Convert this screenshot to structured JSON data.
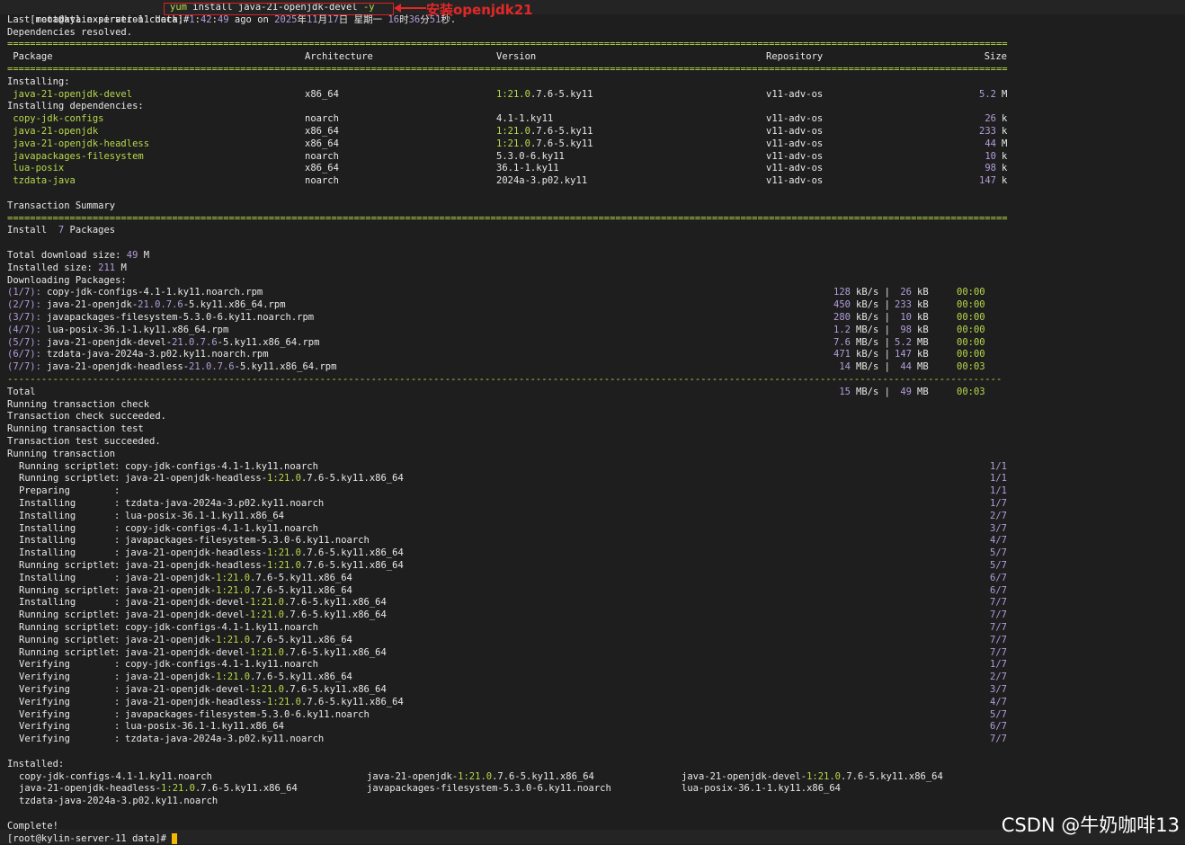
{
  "prompt": "[root@kylin-server-11 data]#",
  "command": "yum install java-21-openjdk-devel -y",
  "annotation": "安装openjdk21",
  "meta_line": "Last metadata expiration check: 1:42:49 ago on 2025年11月17日 星期一 16时36分51秒.",
  "deps_resolved": "Dependencies resolved.",
  "separator": "================================================================================================================================================================================",
  "dash_separator": "-------------------------------------------------------------------------------------------------------------------------------------------------------------------------------",
  "table_headers": {
    "package": "Package",
    "arch": "Architecture",
    "version": "Version",
    "repo": "Repository",
    "size": "Size"
  },
  "installing_label": "Installing:",
  "installing": [
    {
      "name": "java-21-openjdk-devel",
      "arch": "x86_64",
      "version": "1:21.0.7.6-5.ky11",
      "repo": "v11-adv-os",
      "size": "5.2",
      "unit": "M"
    }
  ],
  "deps_label": "Installing dependencies:",
  "dependencies": [
    {
      "name": "copy-jdk-configs",
      "arch": "noarch",
      "version": "4.1-1.ky11",
      "repo": "v11-adv-os",
      "size": "26",
      "unit": "k"
    },
    {
      "name": "java-21-openjdk",
      "arch": "x86_64",
      "version": "1:21.0.7.6-5.ky11",
      "repo": "v11-adv-os",
      "size": "233",
      "unit": "k"
    },
    {
      "name": "java-21-openjdk-headless",
      "arch": "x86_64",
      "version": "1:21.0.7.6-5.ky11",
      "repo": "v11-adv-os",
      "size": "44",
      "unit": "M"
    },
    {
      "name": "javapackages-filesystem",
      "arch": "noarch",
      "version": "5.3.0-6.ky11",
      "repo": "v11-adv-os",
      "size": "10",
      "unit": "k"
    },
    {
      "name": "lua-posix",
      "arch": "x86_64",
      "version": "36.1-1.ky11",
      "repo": "v11-adv-os",
      "size": "98",
      "unit": "k"
    },
    {
      "name": "tzdata-java",
      "arch": "noarch",
      "version": "2024a-3.p02.ky11",
      "repo": "v11-adv-os",
      "size": "147",
      "unit": "k"
    }
  ],
  "summary_label": "Transaction Summary",
  "install_summary": "Install  7 Packages",
  "download_size": "Total download size: 49 M",
  "installed_size": "Installed size: 211 M",
  "downloading_label": "Downloading Packages:",
  "downloads": [
    {
      "idx": "(1/7):",
      "file": "copy-jdk-configs-4.1-1.ky11.noarch.rpm",
      "rate": "128",
      "ru": "kB/s",
      "size": "26",
      "su": "kB",
      "time": "00:00"
    },
    {
      "idx": "(2/7):",
      "file": "java-21-openjdk-21.0.7.6-5.ky11.x86_64.rpm",
      "rate": "450",
      "ru": "kB/s",
      "size": "233",
      "su": "kB",
      "time": "00:00"
    },
    {
      "idx": "(3/7):",
      "file": "javapackages-filesystem-5.3.0-6.ky11.noarch.rpm",
      "rate": "280",
      "ru": "kB/s",
      "size": "10",
      "su": "kB",
      "time": "00:00"
    },
    {
      "idx": "(4/7):",
      "file": "lua-posix-36.1-1.ky11.x86_64.rpm",
      "rate": "1.2",
      "ru": "MB/s",
      "size": "98",
      "su": "kB",
      "time": "00:00"
    },
    {
      "idx": "(5/7):",
      "file": "java-21-openjdk-devel-21.0.7.6-5.ky11.x86_64.rpm",
      "rate": "7.6",
      "ru": "MB/s",
      "size": "5.2",
      "su": "MB",
      "time": "00:00"
    },
    {
      "idx": "(6/7):",
      "file": "tzdata-java-2024a-3.p02.ky11.noarch.rpm",
      "rate": "471",
      "ru": "kB/s",
      "size": "147",
      "su": "kB",
      "time": "00:00"
    },
    {
      "idx": "(7/7):",
      "file": "java-21-openjdk-headless-21.0.7.6-5.ky11.x86_64.rpm",
      "rate": "14",
      "ru": "MB/s",
      "size": "44",
      "su": "MB",
      "time": "00:03"
    }
  ],
  "total": {
    "label": "Total",
    "rate": "15",
    "ru": "MB/s",
    "size": "49",
    "su": "MB",
    "time": "00:03"
  },
  "status_lines": [
    "Running transaction check",
    "Transaction check succeeded.",
    "Running transaction test",
    "Transaction test succeeded.",
    "Running transaction"
  ],
  "transaction": [
    {
      "action": "Running scriptlet",
      "pkg": "copy-jdk-configs-4.1-1.ky11.noarch",
      "prog": "1/1"
    },
    {
      "action": "Running scriptlet",
      "pkg": "java-21-openjdk-headless-1:21.0.7.6-5.ky11.x86_64",
      "prog": "1/1"
    },
    {
      "action": "Preparing        ",
      "pkg": "",
      "prog": "1/1"
    },
    {
      "action": "Installing       ",
      "pkg": "tzdata-java-2024a-3.p02.ky11.noarch",
      "prog": "1/7"
    },
    {
      "action": "Installing       ",
      "pkg": "lua-posix-36.1-1.ky11.x86_64",
      "prog": "2/7"
    },
    {
      "action": "Installing       ",
      "pkg": "copy-jdk-configs-4.1-1.ky11.noarch",
      "prog": "3/7"
    },
    {
      "action": "Installing       ",
      "pkg": "javapackages-filesystem-5.3.0-6.ky11.noarch",
      "prog": "4/7"
    },
    {
      "action": "Installing       ",
      "pkg": "java-21-openjdk-headless-1:21.0.7.6-5.ky11.x86_64",
      "prog": "5/7"
    },
    {
      "action": "Running scriptlet",
      "pkg": "java-21-openjdk-headless-1:21.0.7.6-5.ky11.x86_64",
      "prog": "5/7"
    },
    {
      "action": "Installing       ",
      "pkg": "java-21-openjdk-1:21.0.7.6-5.ky11.x86_64",
      "prog": "6/7"
    },
    {
      "action": "Running scriptlet",
      "pkg": "java-21-openjdk-1:21.0.7.6-5.ky11.x86_64",
      "prog": "6/7"
    },
    {
      "action": "Installing       ",
      "pkg": "java-21-openjdk-devel-1:21.0.7.6-5.ky11.x86_64",
      "prog": "7/7"
    },
    {
      "action": "Running scriptlet",
      "pkg": "java-21-openjdk-devel-1:21.0.7.6-5.ky11.x86_64",
      "prog": "7/7"
    },
    {
      "action": "Running scriptlet",
      "pkg": "copy-jdk-configs-4.1-1.ky11.noarch",
      "prog": "7/7"
    },
    {
      "action": "Running scriptlet",
      "pkg": "java-21-openjdk-1:21.0.7.6-5.ky11.x86_64",
      "prog": "7/7"
    },
    {
      "action": "Running scriptlet",
      "pkg": "java-21-openjdk-devel-1:21.0.7.6-5.ky11.x86_64",
      "prog": "7/7"
    },
    {
      "action": "Verifying        ",
      "pkg": "copy-jdk-configs-4.1-1.ky11.noarch",
      "prog": "1/7"
    },
    {
      "action": "Verifying        ",
      "pkg": "java-21-openjdk-1:21.0.7.6-5.ky11.x86_64",
      "prog": "2/7"
    },
    {
      "action": "Verifying        ",
      "pkg": "java-21-openjdk-devel-1:21.0.7.6-5.ky11.x86_64",
      "prog": "3/7"
    },
    {
      "action": "Verifying        ",
      "pkg": "java-21-openjdk-headless-1:21.0.7.6-5.ky11.x86_64",
      "prog": "4/7"
    },
    {
      "action": "Verifying        ",
      "pkg": "javapackages-filesystem-5.3.0-6.ky11.noarch",
      "prog": "5/7"
    },
    {
      "action": "Verifying        ",
      "pkg": "lua-posix-36.1-1.ky11.x86_64",
      "prog": "6/7"
    },
    {
      "action": "Verifying        ",
      "pkg": "tzdata-java-2024a-3.p02.ky11.noarch",
      "prog": "7/7"
    }
  ],
  "installed_label": "Installed:",
  "installed": [
    "copy-jdk-configs-4.1-1.ky11.noarch",
    "java-21-openjdk-1:21.0.7.6-5.ky11.x86_64",
    "java-21-openjdk-devel-1:21.0.7.6-5.ky11.x86_64",
    "java-21-openjdk-headless-1:21.0.7.6-5.ky11.x86_64",
    "javapackages-filesystem-5.3.0-6.ky11.noarch",
    "lua-posix-36.1-1.ky11.x86_64",
    "tzdata-java-2024a-3.p02.ky11.noarch"
  ],
  "complete": "Complete!",
  "watermark": "CSDN @牛奶咖啡13",
  "colors": {
    "highlight": "#b7d94a",
    "number": "#b39ddb",
    "annotation": "#e32727",
    "cursor": "#f5b800"
  }
}
